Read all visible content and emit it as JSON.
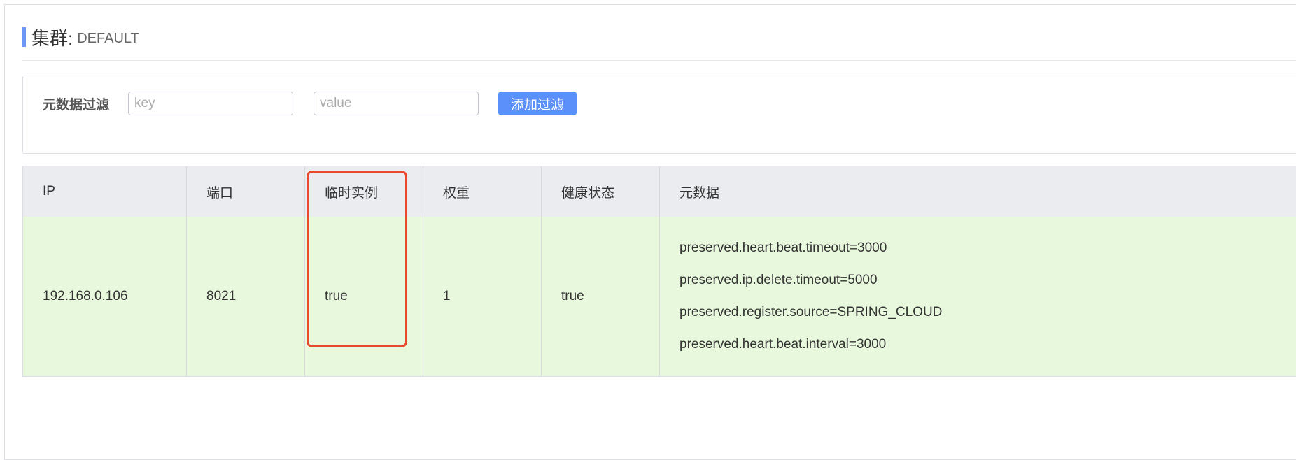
{
  "cluster": {
    "title": "集群:",
    "name": "DEFAULT"
  },
  "filter": {
    "label": "元数据过滤",
    "key_placeholder": "key",
    "key_value": "",
    "value_placeholder": "value",
    "value_value": "",
    "button_label": "添加过滤"
  },
  "table": {
    "headers": [
      "IP",
      "端口",
      "临时实例",
      "权重",
      "健康状态",
      "元数据"
    ],
    "rows": [
      {
        "ip": "192.168.0.106",
        "port": "8021",
        "ephemeral": "true",
        "weight": "1",
        "healthy": "true",
        "metadata": [
          "preserved.heart.beat.timeout=3000",
          "preserved.ip.delete.timeout=5000",
          "preserved.register.source=SPRING_CLOUD",
          "preserved.heart.beat.interval=3000"
        ]
      }
    ]
  },
  "colors": {
    "accent": "#6d97f5",
    "button": "#5b8ff9",
    "row_background": "#e8f8dc",
    "header_background": "#ebecf0",
    "highlight": "#e84a2e"
  }
}
